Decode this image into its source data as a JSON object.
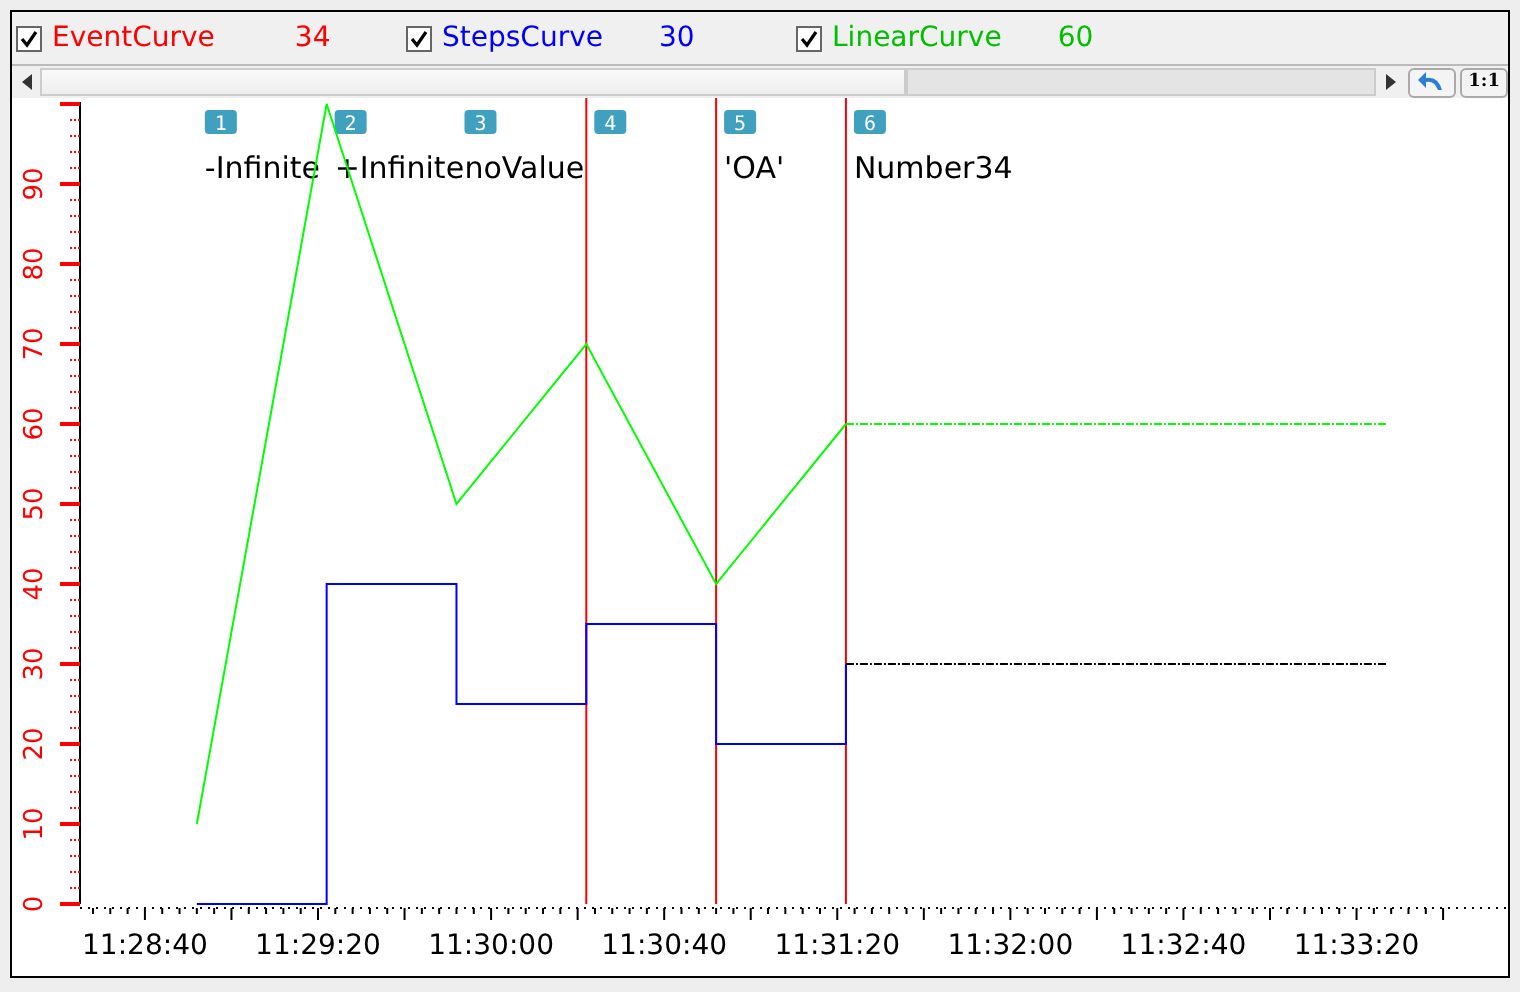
{
  "legend": [
    {
      "name": "EventCurve",
      "value": "34",
      "checked": true,
      "color": "#ff0000"
    },
    {
      "name": "StepsCurve",
      "value": "30",
      "checked": true,
      "color": "#0000ff"
    },
    {
      "name": "LinearCurve",
      "value": "60",
      "checked": true,
      "color": "#00c000"
    }
  ],
  "toolbar": {
    "zoom_button": "1:1"
  },
  "events": [
    {
      "marker": "1",
      "label": "-Infinite"
    },
    {
      "marker": "2",
      "label": "+Infinite"
    },
    {
      "marker": "3",
      "label": "noValue"
    },
    {
      "marker": "4"
    },
    {
      "marker": "5",
      "label": "'OA'"
    },
    {
      "marker": "6",
      "label": "Number34"
    }
  ],
  "chart_data": {
    "type": "line",
    "x": [
      41332,
      41362,
      41392,
      41422,
      41452,
      41482
    ],
    "series": [
      {
        "color": "#00ff00",
        "values": [
          10,
          100,
          50,
          70,
          40,
          60
        ]
      },
      {
        "color": "#0000ff",
        "x": [
          41332,
          41362,
          41362,
          41392,
          41392,
          41422,
          41422,
          41452,
          41452,
          41482,
          41482
        ],
        "values": [
          0,
          0,
          40,
          40,
          25,
          25,
          35,
          35,
          20,
          20,
          30
        ]
      },
      {
        "color": "#00ff00",
        "x": [
          41482,
          41607
        ],
        "values": [
          60,
          60
        ],
        "line_style": "dashdot"
      },
      {
        "color": "#000000",
        "x": [
          41482,
          41607
        ],
        "values": [
          30,
          30
        ],
        "line_style": "dashdot"
      }
    ],
    "ylim": [
      0,
      100
    ],
    "xlim": [
      41305,
      41635
    ],
    "yticks": [
      0,
      10,
      20,
      30,
      40,
      50,
      60,
      70,
      80,
      90
    ],
    "xticks": [
      {
        "value": 41320,
        "label": "11:28:40"
      },
      {
        "value": 41360,
        "label": "11:29:20"
      },
      {
        "value": 41400,
        "label": "11:30:00"
      },
      {
        "value": 41440,
        "label": "11:30:40"
      },
      {
        "value": 41480,
        "label": "11:31:20"
      },
      {
        "value": 41520,
        "label": "11:32:00"
      },
      {
        "value": 41560,
        "label": "11:32:40"
      },
      {
        "value": 41600,
        "label": "11:33:20"
      }
    ],
    "ref_lines": [
      {
        "axis": "x",
        "value": 41422,
        "color": "#ff0000"
      },
      {
        "axis": "x",
        "value": 41452,
        "color": "#ff0000"
      },
      {
        "axis": "x",
        "value": 41482,
        "color": "#ff0000"
      }
    ]
  }
}
